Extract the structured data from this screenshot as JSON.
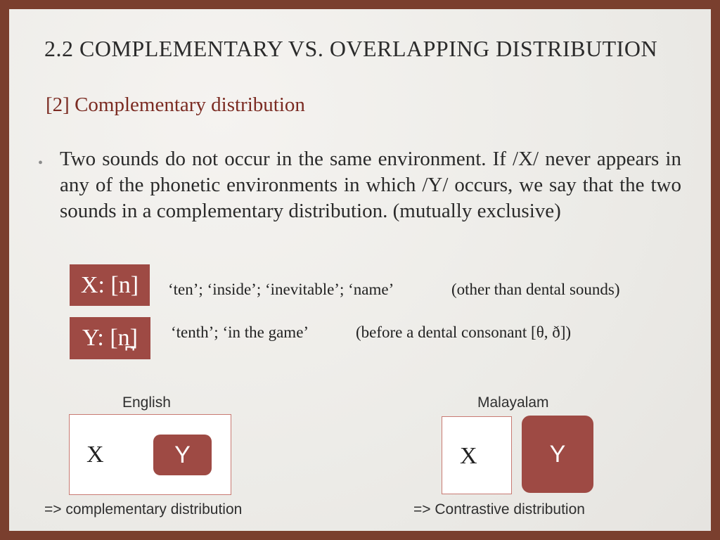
{
  "title": "2.2 COMPLEMENTARY VS. OVERLAPPING DISTRIBUTION",
  "subtitle": "[2] Complementary distribution",
  "bullet": {
    "marker": "•",
    "text": "Two sounds do not occur in the same environment. If /X/ never appears in any of the phonetic environments in which /Y/ occurs, we say that the two sounds in a complementary distribution. (mutually exclusive)"
  },
  "examples": [
    {
      "label": "X: [n]",
      "words": "‘ten’; ‘inside’; ‘inevitable’; ‘name’",
      "note": "(other than dental sounds)"
    },
    {
      "label": "Y: [n̪]",
      "words": "‘tenth’; ‘in the game’",
      "note": "(before a dental consonant [θ, ð])"
    }
  ],
  "diagrams": {
    "english": {
      "heading": "English",
      "x_label": "X",
      "y_label": "Y",
      "conclusion": "=> complementary distribution"
    },
    "malayalam": {
      "heading": "Malayalam",
      "x_label": "X",
      "y_label": "Y",
      "conclusion": "=> Contrastive distribution"
    }
  },
  "colors": {
    "accent": "#9e4a44",
    "frame": "#7a3f2e",
    "subtitle": "#7b2b22"
  }
}
